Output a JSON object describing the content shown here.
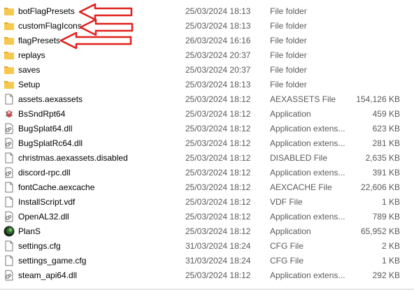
{
  "files": [
    {
      "name": "botFlagPresets",
      "date": "25/03/2024 18:13",
      "type": "File folder",
      "size": "",
      "icon": "folder-icon"
    },
    {
      "name": "customFlagIcons",
      "date": "25/03/2024 18:13",
      "type": "File folder",
      "size": "",
      "icon": "folder-icon"
    },
    {
      "name": "flagPresets",
      "date": "26/03/2024 16:16",
      "type": "File folder",
      "size": "",
      "icon": "folder-icon"
    },
    {
      "name": "replays",
      "date": "25/03/2024 20:37",
      "type": "File folder",
      "size": "",
      "icon": "folder-icon"
    },
    {
      "name": "saves",
      "date": "25/03/2024 20:37",
      "type": "File folder",
      "size": "",
      "icon": "folder-icon"
    },
    {
      "name": "Setup",
      "date": "25/03/2024 18:13",
      "type": "File folder",
      "size": "",
      "icon": "folder-icon"
    },
    {
      "name": "assets.aexassets",
      "date": "25/03/2024 18:12",
      "type": "AEXASSETS File",
      "size": "154,126 KB",
      "icon": "file-icon"
    },
    {
      "name": "BsSndRpt64",
      "date": "25/03/2024 18:12",
      "type": "Application",
      "size": "459 KB",
      "icon": "bugreport-app-icon"
    },
    {
      "name": "BugSplat64.dll",
      "date": "25/03/2024 18:12",
      "type": "Application extens...",
      "size": "623 KB",
      "icon": "dll-icon"
    },
    {
      "name": "BugSplatRc64.dll",
      "date": "25/03/2024 18:12",
      "type": "Application extens...",
      "size": "281 KB",
      "icon": "dll-icon"
    },
    {
      "name": "christmas.aexassets.disabled",
      "date": "25/03/2024 18:12",
      "type": "DISABLED File",
      "size": "2,635 KB",
      "icon": "file-icon"
    },
    {
      "name": "discord-rpc.dll",
      "date": "25/03/2024 18:12",
      "type": "Application extens...",
      "size": "391 KB",
      "icon": "dll-icon"
    },
    {
      "name": "fontCache.aexcache",
      "date": "25/03/2024 18:12",
      "type": "AEXCACHE File",
      "size": "22,606 KB",
      "icon": "file-icon"
    },
    {
      "name": "InstallScript.vdf",
      "date": "25/03/2024 18:12",
      "type": "VDF File",
      "size": "1 KB",
      "icon": "file-icon"
    },
    {
      "name": "OpenAL32.dll",
      "date": "25/03/2024 18:12",
      "type": "Application extens...",
      "size": "789 KB",
      "icon": "dll-icon"
    },
    {
      "name": "PlanS",
      "date": "25/03/2024 18:12",
      "type": "Application",
      "size": "65,952 KB",
      "icon": "game-app-icon"
    },
    {
      "name": "settings.cfg",
      "date": "31/03/2024 18:24",
      "type": "CFG File",
      "size": "2 KB",
      "icon": "file-icon"
    },
    {
      "name": "settings_game.cfg",
      "date": "31/03/2024 18:24",
      "type": "CFG File",
      "size": "1 KB",
      "icon": "file-icon"
    },
    {
      "name": "steam_api64.dll",
      "date": "25/03/2024 18:12",
      "type": "Application extens...",
      "size": "292 KB",
      "icon": "dll-icon"
    }
  ],
  "colors": {
    "folder": "#f6c94d",
    "folder_dark": "#e3a92b",
    "arrow": "#e0201c",
    "secondary_text": "#5a5a5a"
  }
}
